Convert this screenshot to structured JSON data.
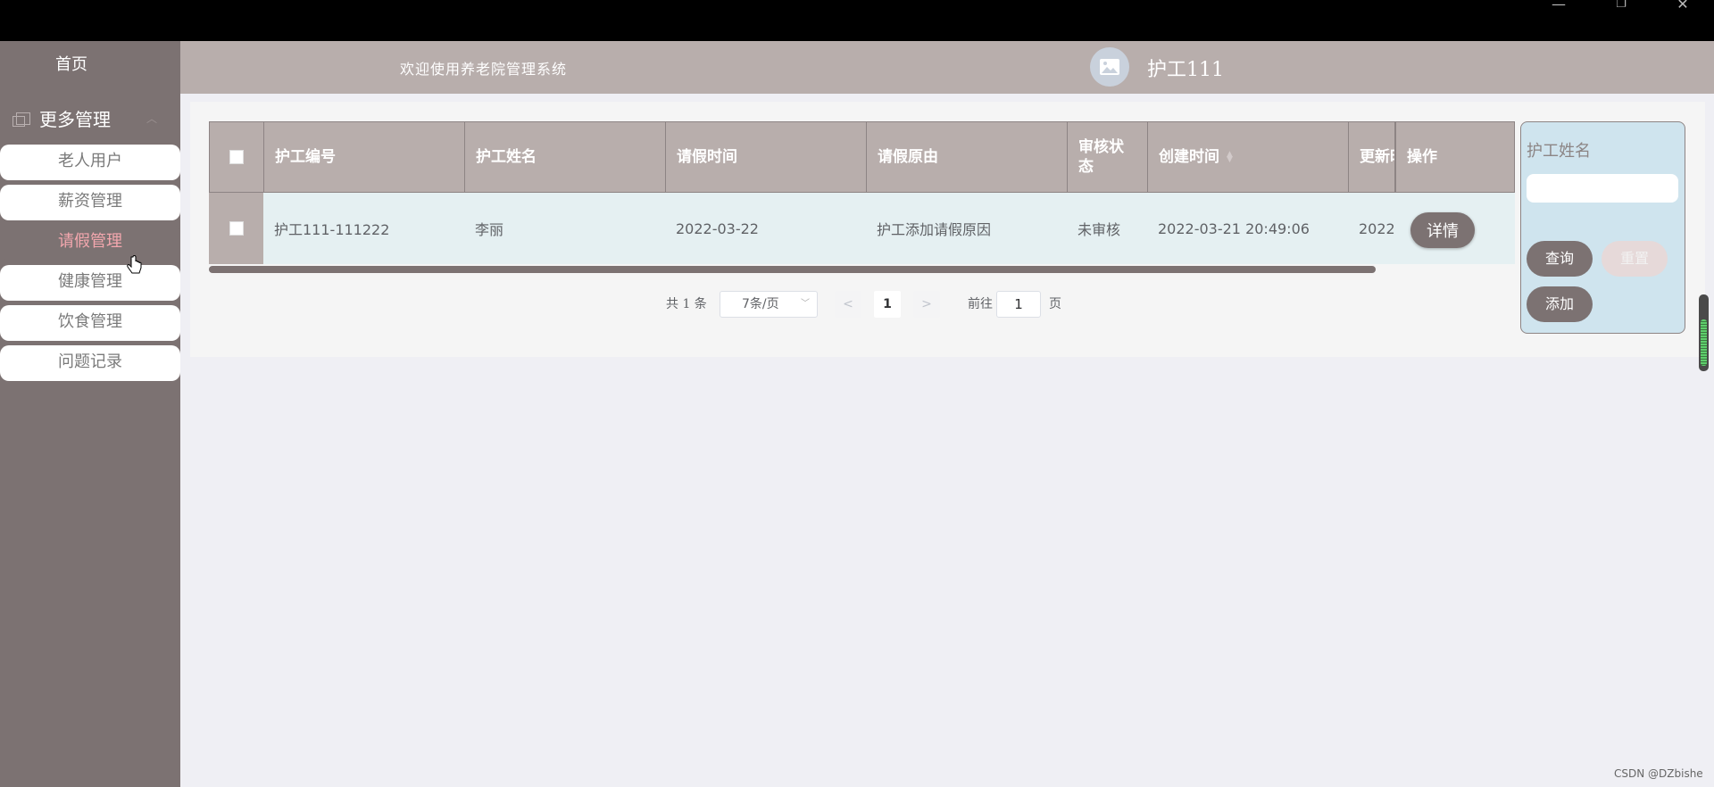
{
  "window": {
    "minimize_glyph": "—",
    "maximize_glyph": "❐",
    "close_glyph": "✕"
  },
  "sidebar": {
    "home_label": "首页",
    "group_label": "更多管理",
    "items": [
      {
        "label": "老人用户",
        "active": false
      },
      {
        "label": "薪资管理",
        "active": false
      },
      {
        "label": "请假管理",
        "active": true
      },
      {
        "label": "健康管理",
        "active": false
      },
      {
        "label": "饮食管理",
        "active": false
      },
      {
        "label": "问题记录",
        "active": false
      }
    ]
  },
  "header": {
    "welcome": "欢迎使用养老院管理系统",
    "avatar_icon": "image-icon",
    "username": "护工111"
  },
  "table": {
    "columns": [
      "护工编号",
      "护工姓名",
      "请假时间",
      "请假原由",
      "审核状态",
      "创建时间",
      "更新时",
      "操作"
    ],
    "rows": [
      {
        "nurse_id": "护工111-111222",
        "nurse_name": "李丽",
        "leave_date": "2022-03-22",
        "reason": "护工添加请假原因",
        "status": "未审核",
        "created": "2022-03-21 20:49:06",
        "updated": "2022",
        "action": "详情"
      }
    ]
  },
  "pagination": {
    "total": "共 1 条",
    "page_size": "7条/页",
    "current_page": "1",
    "goto_label": "前往",
    "goto_value": "1",
    "page_suffix": "页"
  },
  "search": {
    "label": "护工姓名",
    "value": "",
    "query_label": "查询",
    "reset_label": "重置",
    "add_label": "添加"
  },
  "watermark": "CSDN @DZbishe",
  "colors": {
    "sidebar": "#7c7272",
    "header": "#b8aeac",
    "active_item": "#f3a7ae",
    "search_box": "#cfe4ee"
  }
}
